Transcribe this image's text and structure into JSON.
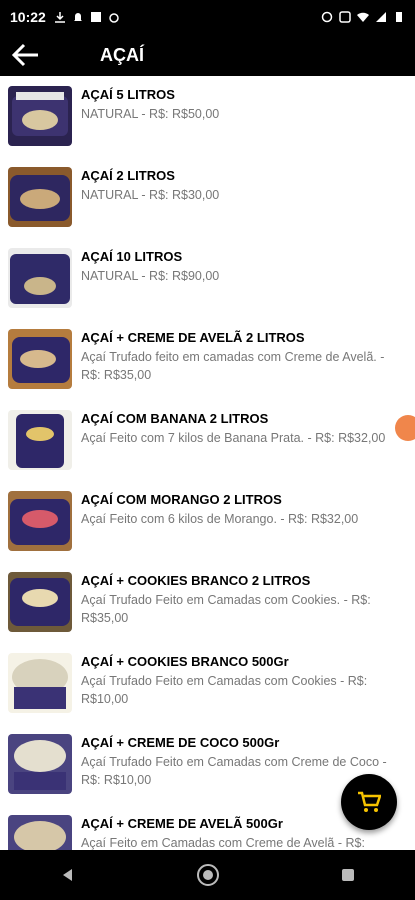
{
  "status_bar": {
    "time": "10:22"
  },
  "app_bar": {
    "title": "AÇAÍ"
  },
  "colors": {
    "bar": "#000000",
    "accent": "#f6c300",
    "badge": "#f0864b",
    "desc": "#777777"
  },
  "products": [
    {
      "name": "AÇAÍ  5 LITROS",
      "description": "NATURAL - R$: R$50,00"
    },
    {
      "name": "AÇAÍ  2 LITROS",
      "description": "NATURAL - R$: R$30,00"
    },
    {
      "name": "AÇAÍ  10 LITROS",
      "description": "NATURAL - R$: R$90,00"
    },
    {
      "name": "AÇAÍ + CREME DE AVELÃ 2 LITROS",
      "description": "Açaí Trufado feito em camadas com Creme de Avelã. - R$: R$35,00"
    },
    {
      "name": "AÇAÍ COM BANANA 2 LITROS",
      "description": "Açaí Feito com 7 kilos de Banana Prata. - R$: R$32,00"
    },
    {
      "name": "AÇAÍ COM MORANGO 2 LITROS",
      "description": "Açaí Feito com 6 kilos de Morango. - R$: R$32,00"
    },
    {
      "name": "AÇAÍ + COOKIES BRANCO 2 LITROS",
      "description": "Açaí Trufado Feito em Camadas com Cookies. - R$: R$35,00"
    },
    {
      "name": "AÇAÍ + COOKIES BRANCO 500Gr",
      "description": "Açaí Trufado Feito em Camadas com Cookies  - R$: R$10,00"
    },
    {
      "name": "AÇAÍ + CREME DE COCO 500Gr",
      "description": "Açaí Trufado Feito em Camadas com Creme de Coco - R$: R$10,00"
    },
    {
      "name": "AÇAÍ + CREME DE AVELÃ 500Gr",
      "description": "Açaí Feito em Camadas com Creme de Avelã - R$:"
    }
  ]
}
